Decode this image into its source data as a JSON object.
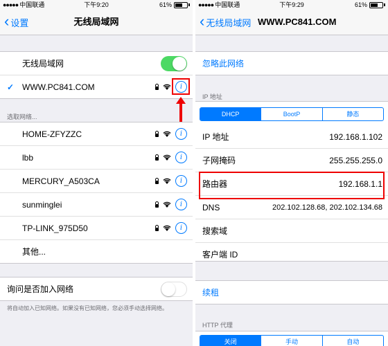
{
  "left": {
    "status": {
      "carrier": "中国联通",
      "time": "下午9:20",
      "battery": "61%"
    },
    "nav": {
      "back_label": "设置",
      "title": "无线局域网"
    },
    "wlan_label": "无线局域网",
    "connected_network": "WWW.PC841.COM",
    "choose_label": "选取网络...",
    "networks": [
      "HOME-ZFYZZC",
      "lbb",
      "MERCURY_A503CA",
      "sunminglei",
      "TP-LINK_975D50"
    ],
    "other_label": "其他...",
    "ask_label": "询问是否加入网络",
    "ask_note": "将自动加入已知网络。如果没有已知网络，您必须手动选择网络。"
  },
  "right": {
    "status": {
      "carrier": "中国联通",
      "time": "下午9:29",
      "battery": "61%"
    },
    "nav": {
      "back_label": "无线局域网",
      "title": "WWW.PC841.COM"
    },
    "forget_label": "忽略此网络",
    "ip_section": "IP 地址",
    "ip_modes": [
      "DHCP",
      "BootP",
      "静态"
    ],
    "ip_rows": [
      {
        "label": "IP 地址",
        "value": "192.168.1.102"
      },
      {
        "label": "子网掩码",
        "value": "255.255.255.0"
      },
      {
        "label": "路由器",
        "value": "192.168.1.1"
      },
      {
        "label": "DNS",
        "value": "202.102.128.68, 202.102.134.68"
      },
      {
        "label": "搜索域",
        "value": ""
      },
      {
        "label": "客户端 ID",
        "value": ""
      }
    ],
    "renew_label": "续租",
    "proxy_section": "HTTP 代理",
    "proxy_modes": [
      "关闭",
      "手动",
      "自动"
    ]
  },
  "colors": {
    "accent": "#007aff",
    "toggle_on": "#4cd964",
    "highlight": "#ee0000",
    "background": "#efeff4"
  },
  "icons": [
    "back-chevron-icon",
    "checkmark-icon",
    "lock-icon",
    "wifi-icon",
    "info-icon",
    "red-arrow-icon"
  ]
}
